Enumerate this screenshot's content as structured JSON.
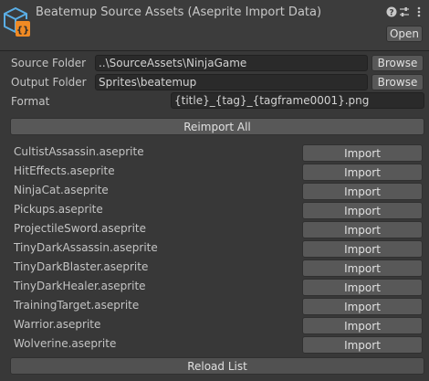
{
  "header": {
    "title": "Beatemup Source Assets (Aseprite Import Data)",
    "open_label": "Open",
    "icons": [
      "asset-script-icon",
      "help-icon",
      "preset-sliders-icon",
      "more-options-icon"
    ]
  },
  "fields": {
    "source_folder": {
      "label": "Source Folder",
      "value": "..\\SourceAssets\\NinjaGame",
      "button": "Browse"
    },
    "output_folder": {
      "label": "Output Folder",
      "value": "Sprites\\beatemup",
      "button": "Browse"
    },
    "format": {
      "label": "Format",
      "value": "{title}_{tag}_{tagframe0001}.png"
    }
  },
  "reimport_all_label": "Reimport All",
  "files": [
    {
      "name": "CultistAssassin.aseprite",
      "button": "Import"
    },
    {
      "name": "HitEffects.aseprite",
      "button": "Import"
    },
    {
      "name": "NinjaCat.aseprite",
      "button": "Import"
    },
    {
      "name": "Pickups.aseprite",
      "button": "Import"
    },
    {
      "name": "ProjectileSword.aseprite",
      "button": "Import"
    },
    {
      "name": "TinyDarkAssassin.aseprite",
      "button": "Import"
    },
    {
      "name": "TinyDarkBlaster.aseprite",
      "button": "Import"
    },
    {
      "name": "TinyDarkHealer.aseprite",
      "button": "Import"
    },
    {
      "name": "TrainingTarget.aseprite",
      "button": "Import"
    },
    {
      "name": "Warrior.aseprite",
      "button": "Import"
    },
    {
      "name": "Wolverine.aseprite",
      "button": "Import"
    }
  ],
  "reload_list_label": "Reload List",
  "colors": {
    "background": "#383838",
    "header": "#3c3c3c",
    "button": "#585858",
    "field": "#2a2a2a",
    "icon_blue": "#5aaee6",
    "icon_orange": "#f08a24"
  }
}
